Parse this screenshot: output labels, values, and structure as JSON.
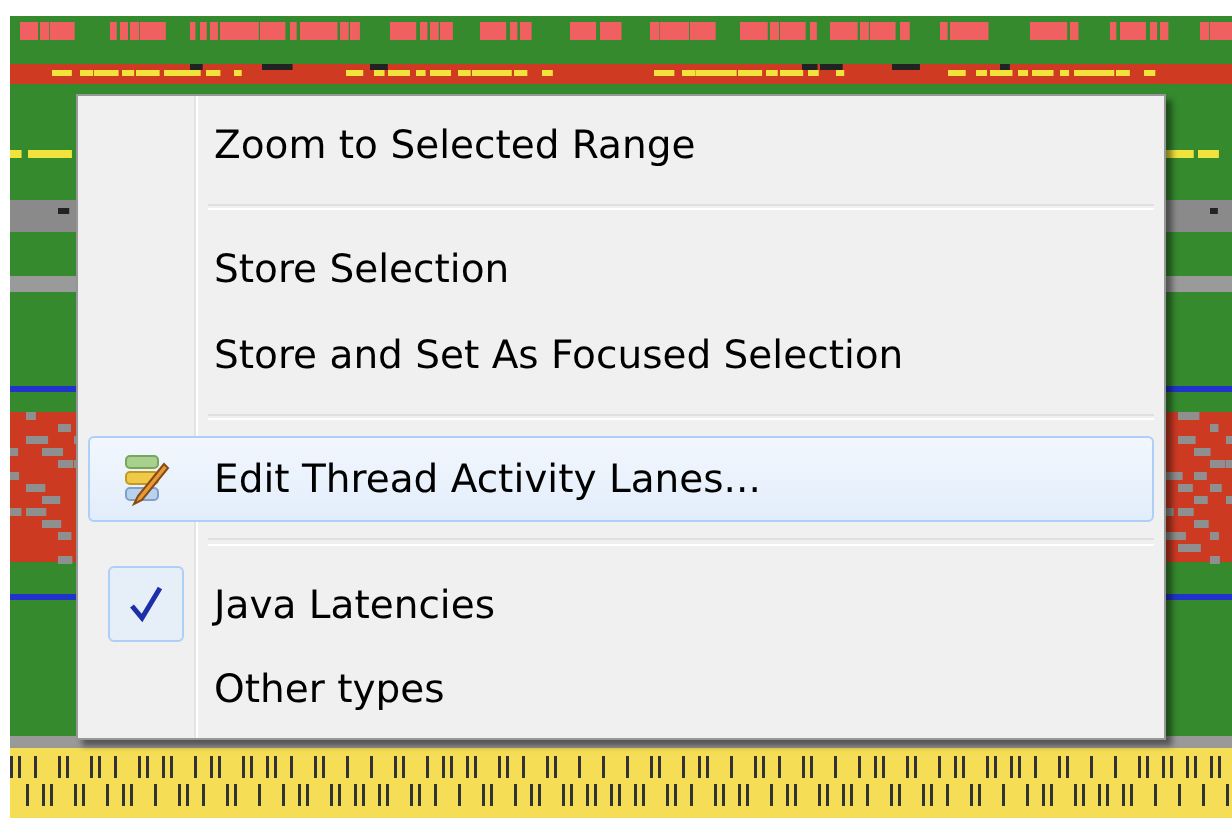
{
  "context_menu": {
    "items": [
      {
        "kind": "action",
        "label": "Zoom to Selected Range",
        "selected": false
      },
      {
        "kind": "separator"
      },
      {
        "kind": "action",
        "label": "Store Selection",
        "selected": false
      },
      {
        "kind": "action",
        "label": "Store and Set As Focused Selection",
        "selected": false
      },
      {
        "kind": "separator"
      },
      {
        "kind": "action",
        "label": "Edit Thread Activity Lanes...",
        "selected": true,
        "icon": true
      },
      {
        "kind": "separator"
      },
      {
        "kind": "check",
        "label": "Java Latencies",
        "selected": false,
        "checked": true
      },
      {
        "kind": "check",
        "label": "Other types",
        "selected": false,
        "checked": false
      }
    ]
  }
}
